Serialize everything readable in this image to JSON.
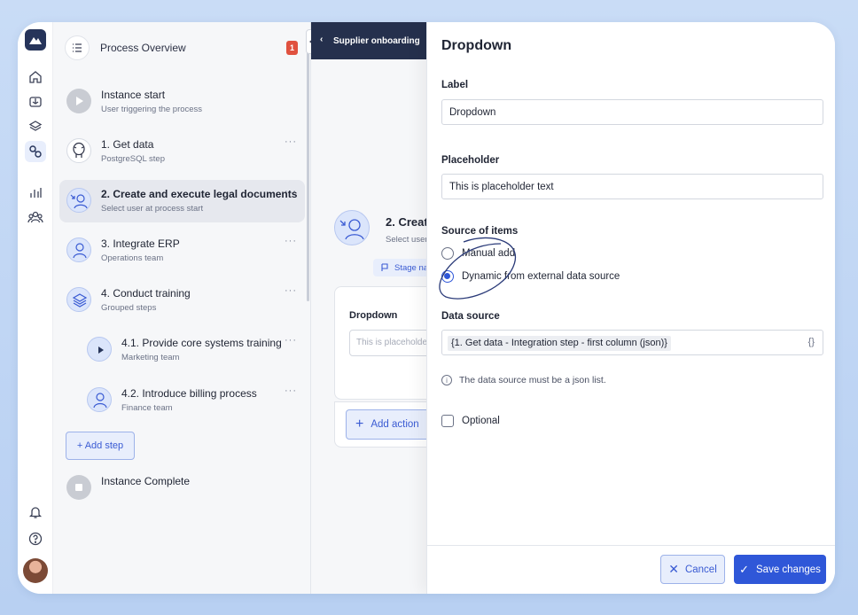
{
  "process": {
    "overview_label": "Process Overview",
    "badge_count": "1",
    "add_step_label": "+ Add step",
    "steps": [
      {
        "title": "Instance start",
        "subtitle": "User triggering the process",
        "dots": ""
      },
      {
        "title": "1. Get data",
        "subtitle": "PostgreSQL step",
        "dots": "···"
      },
      {
        "title": "2. Create and execute legal documents",
        "subtitle": "Select user at process start",
        "dots": "···"
      },
      {
        "title": "3. Integrate ERP",
        "subtitle": "Operations team",
        "dots": "···"
      },
      {
        "title": "4. Conduct training",
        "subtitle": "Grouped steps",
        "dots": "···"
      },
      {
        "title": "4.1. Provide core systems training",
        "subtitle": "Marketing team",
        "dots": "···"
      },
      {
        "title": "4.2. Introduce billing process",
        "subtitle": "Finance team",
        "dots": "···"
      },
      {
        "title": "Instance Complete",
        "subtitle": "",
        "dots": ""
      }
    ]
  },
  "canvas": {
    "header_title": "Supplier onboarding",
    "stage_title": "2. Creat",
    "stage_subtitle": "Select user",
    "stage_chip": "Stage na",
    "card_label": "Dropdown",
    "card_placeholder": "This is placeholder",
    "add_action_label": "Add action"
  },
  "panel": {
    "title": "Dropdown",
    "label_label": "Label",
    "label_value": "Dropdown",
    "placeholder_label": "Placeholder",
    "placeholder_value": "This is placeholder text",
    "source_label": "Source of items",
    "option_manual": "Manual add",
    "option_dynamic": "Dynamic from external data source",
    "selected_option": "Dynamic from external data source",
    "datasource_label": "Data source",
    "datasource_value": "{1. Get data - Integration step - first column (json)}",
    "datasource_braces": "{}",
    "hint": "The data source must be a json list.",
    "optional_label": "Optional",
    "cancel_label": "Cancel",
    "save_label": "Save changes"
  },
  "colors": {
    "accent": "#2f57d8",
    "navy": "#25304d",
    "badge": "#e0513f"
  }
}
